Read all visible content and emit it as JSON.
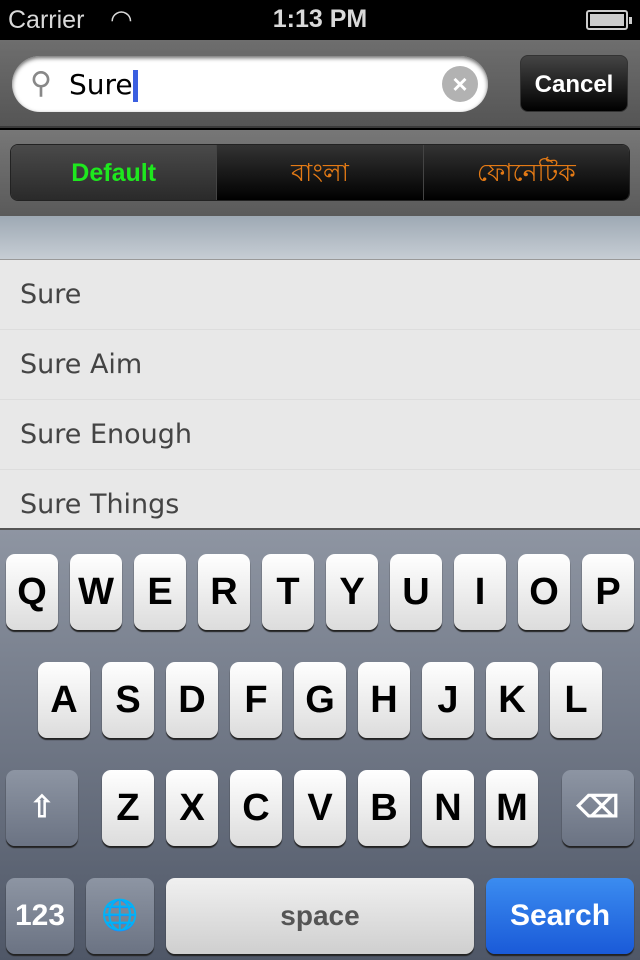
{
  "status": {
    "carrier": "Carrier",
    "time": "1:13 PM",
    "wifi_icon": "wifi-icon",
    "battery_icon": "battery-icon"
  },
  "search": {
    "value": "Sure",
    "cancel": "Cancel",
    "search_icon": "magnifier-icon",
    "clear_icon": "clear-icon"
  },
  "segments": [
    {
      "label": "Default",
      "selected": true
    },
    {
      "label": "বাংলা",
      "selected": false
    },
    {
      "label": "ফোনেটিক",
      "selected": false
    }
  ],
  "colors": {
    "selected_segment": "#1ee81e",
    "segment_text": "#e47a15",
    "search_key": "#2a6fe6"
  },
  "results": [
    "Sure",
    "Sure Aim",
    "Sure Enough",
    "Sure Things"
  ],
  "keyboard": {
    "row1": [
      "Q",
      "W",
      "E",
      "R",
      "T",
      "Y",
      "U",
      "I",
      "O",
      "P"
    ],
    "row2": [
      "A",
      "S",
      "D",
      "F",
      "G",
      "H",
      "J",
      "K",
      "L"
    ],
    "row3": [
      "Z",
      "X",
      "C",
      "V",
      "B",
      "N",
      "M"
    ],
    "numbers": "123",
    "space": "space",
    "search": "Search",
    "shift_icon": "shift-icon",
    "backspace_icon": "backspace-icon",
    "globe_icon": "globe-icon"
  }
}
